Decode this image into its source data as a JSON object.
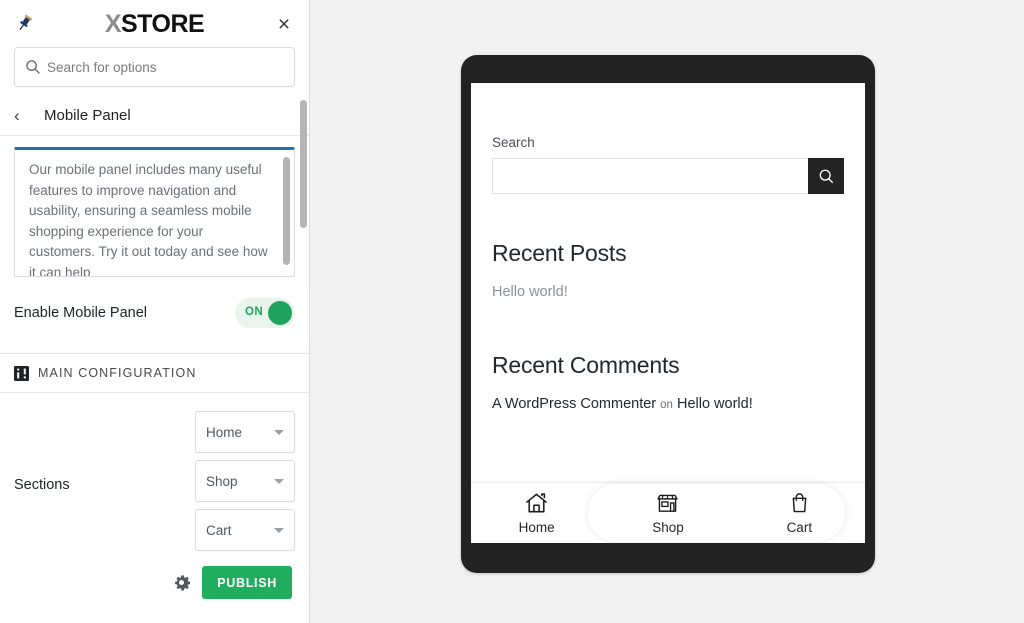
{
  "panel": {
    "pin_icon": "pushpin-icon",
    "logo": {
      "prefix": "X",
      "suffix": "STORE"
    },
    "close_label": "×",
    "search": {
      "placeholder": "Search for options",
      "value": "",
      "icon": "search-icon"
    },
    "breadcrumb": {
      "back_icon": "‹",
      "title": "Mobile Panel"
    },
    "description": "Our mobile panel includes many useful features to improve navigation and usability, ensuring a seamless mobile shopping experience for your customers. Try it out today and see how it can help",
    "enable_toggle": {
      "label": "Enable Mobile Panel",
      "state": "ON"
    },
    "main_configuration": {
      "icon": "configuration-icon",
      "label": "MAIN CONFIGURATION"
    },
    "sections": {
      "label": "Sections",
      "items": [
        {
          "value": "Home"
        },
        {
          "value": "Shop"
        },
        {
          "value": "Cart"
        }
      ]
    },
    "footer": {
      "gear_icon": "gear-icon",
      "publish_label": "PUBLISH"
    },
    "collapse_icon": "‹"
  },
  "preview": {
    "search_widget": {
      "title": "Search",
      "value": "",
      "button_icon": "search-icon"
    },
    "recent_posts": {
      "title": "Recent Posts",
      "items": [
        "Hello world!"
      ]
    },
    "recent_comments": {
      "title": "Recent Comments",
      "author": "A WordPress Commenter",
      "connector": "on",
      "post": "Hello world!"
    },
    "mobile_nav": [
      {
        "icon": "home-icon",
        "label": "Home"
      },
      {
        "icon": "shop-icon",
        "label": "Shop"
      },
      {
        "icon": "cart-icon",
        "label": "Cart"
      }
    ]
  },
  "colors": {
    "accent_green": "#21ad5e",
    "accent_blue": "#2271b1",
    "device_bezel": "#222222",
    "panel_bg": "#ffffff",
    "canvas_bg": "#f1f1f1"
  }
}
